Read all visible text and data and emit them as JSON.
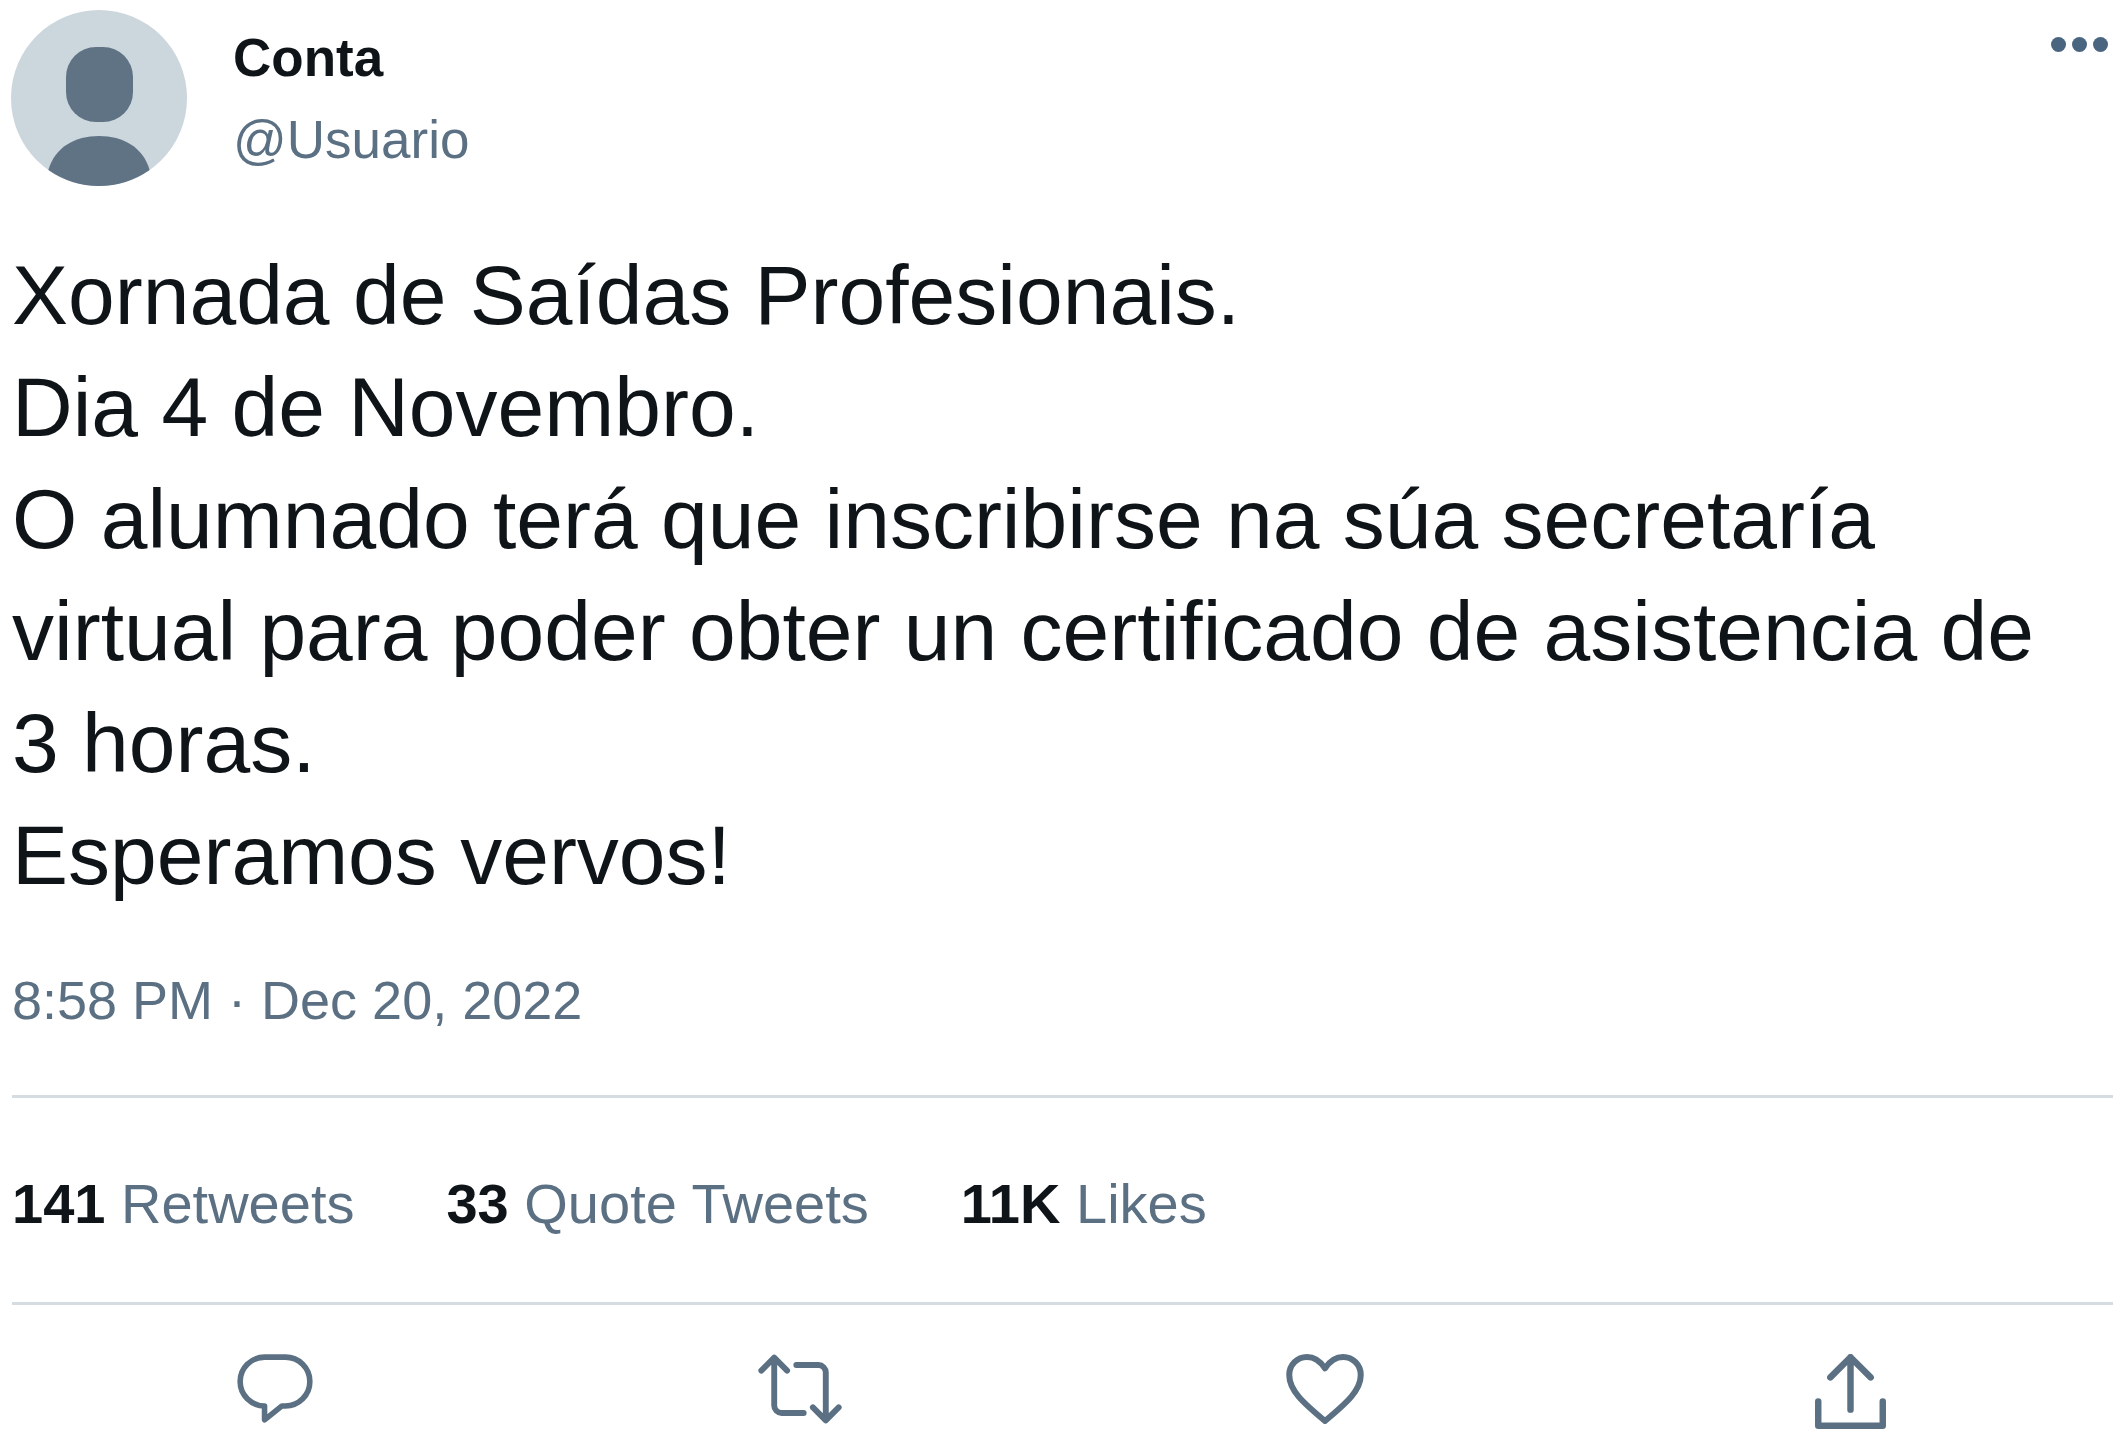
{
  "tweet": {
    "author": {
      "name": "Conta",
      "handle": "@Usuario"
    },
    "text": "Xornada de Saídas Profesionais.\nDia 4 de Novembro.\nO alumnado terá que inscribirse na súa secretaría virtual para poder obter un certificado de asistencia de 3 horas.\nEsperamos vervos!",
    "timestamp": "8:58 PM · Dec 20, 2022",
    "stats": [
      {
        "count": "141",
        "label": "Retweets"
      },
      {
        "count": "33",
        "label": "Quote Tweets"
      },
      {
        "count": "11K",
        "label": "Likes"
      }
    ],
    "actions": [
      {
        "kind": "reply"
      },
      {
        "kind": "retweet"
      },
      {
        "kind": "like"
      },
      {
        "kind": "share"
      }
    ]
  }
}
